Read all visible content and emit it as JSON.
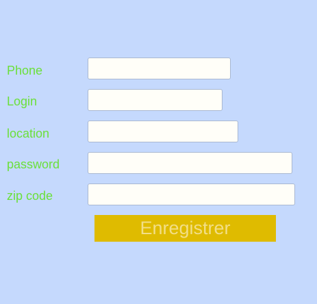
{
  "form": {
    "fields": [
      {
        "label": "Phone",
        "value": "",
        "placeholder": ""
      },
      {
        "label": "Login",
        "value": "",
        "placeholder": ""
      },
      {
        "label": "location",
        "value": "",
        "placeholder": ""
      },
      {
        "label": "password",
        "value": "",
        "placeholder": ""
      },
      {
        "label": "zip code",
        "value": "",
        "placeholder": ""
      }
    ],
    "submit_label": "Enregistrer"
  },
  "colors": {
    "background": "#c5d9fd",
    "label_text": "#6be03a",
    "field_background": "#fffef8",
    "field_border": "#a9b8d1",
    "button_background": "#dfbb00",
    "button_text": "#f2de87"
  }
}
